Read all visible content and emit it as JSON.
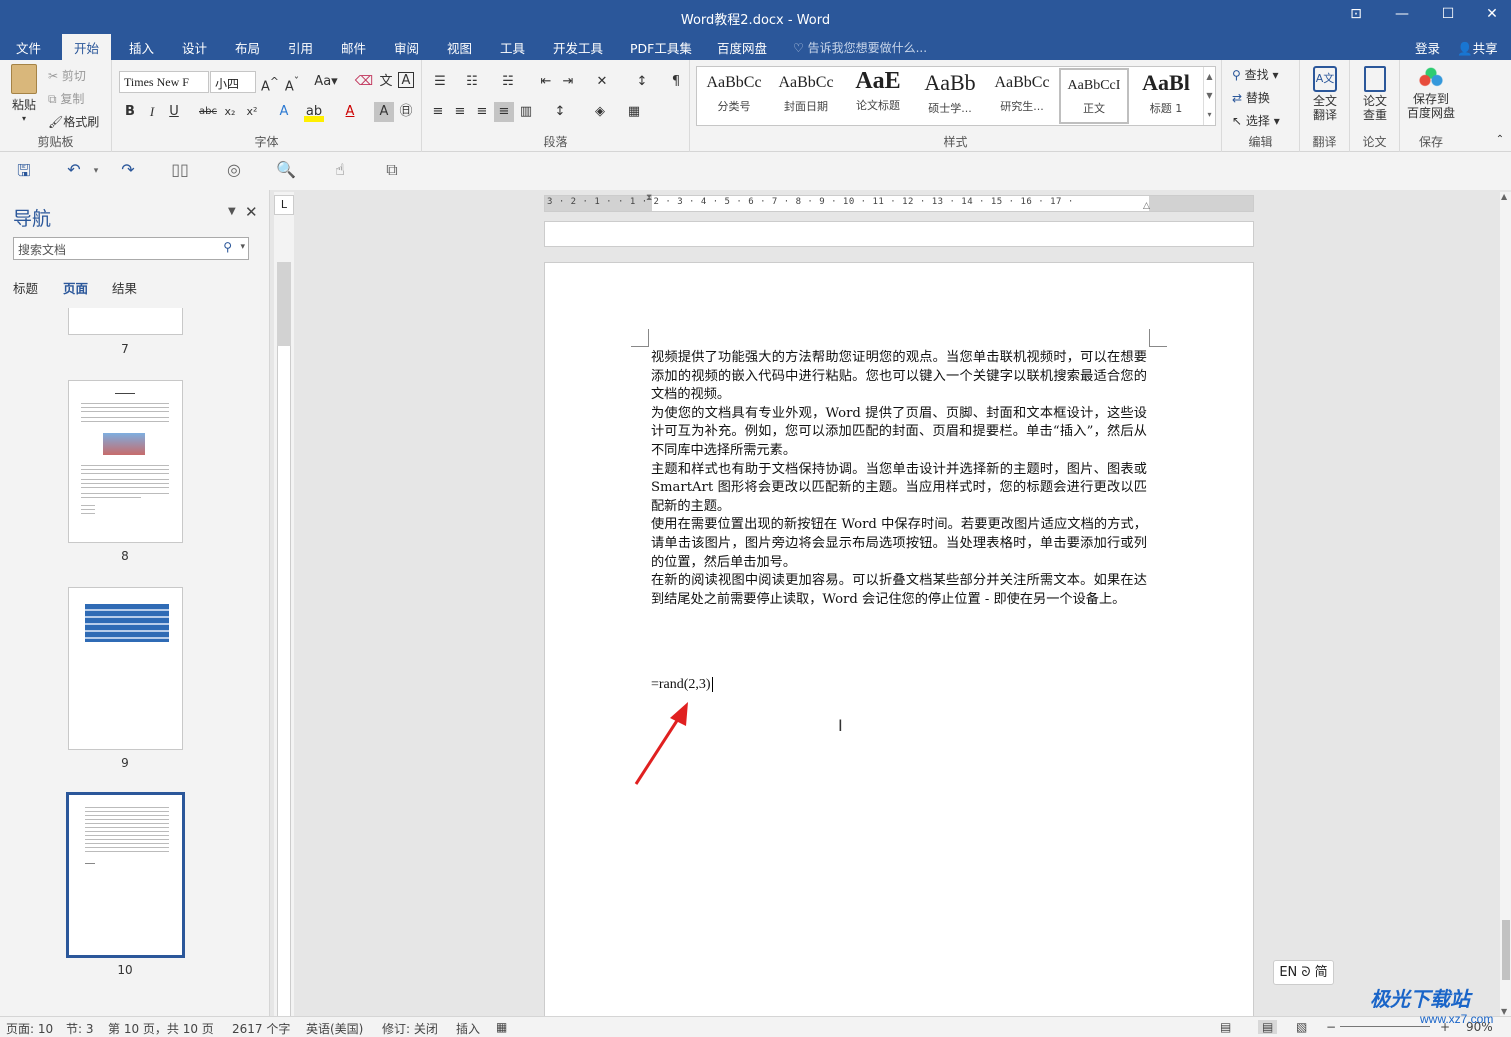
{
  "window": {
    "title": "Word教程2.docx - Word"
  },
  "tabs": [
    "文件",
    "开始",
    "插入",
    "设计",
    "布局",
    "引用",
    "邮件",
    "审阅",
    "视图",
    "工具",
    "开发工具",
    "PDF工具集",
    "百度网盘"
  ],
  "tell_me": "告诉我您想要做什么...",
  "account": {
    "login": "登录",
    "share": "共享"
  },
  "ribbon": {
    "clipboard": {
      "paste": "粘贴",
      "cut": "剪切",
      "copy": "复制",
      "format_painter": "格式刷",
      "label": "剪贴板"
    },
    "font": {
      "name": "Times New F",
      "size": "小四",
      "label": "字体"
    },
    "paragraph": {
      "label": "段落"
    },
    "styles": {
      "label": "样式",
      "items": [
        {
          "preview": "AaBbCc",
          "name": "分类号"
        },
        {
          "preview": "AaBbCc",
          "name": "封面日期"
        },
        {
          "preview": "AaE",
          "name": "论文标题"
        },
        {
          "preview": "AaBb",
          "name": "硕士学..."
        },
        {
          "preview": "AaBbCc",
          "name": "研究生..."
        },
        {
          "preview": "AaBbCcI",
          "name": "正文"
        },
        {
          "preview": "AaBl",
          "name": "标题 1"
        }
      ]
    },
    "editing": {
      "find": "查找",
      "replace": "替换",
      "select": "选择",
      "label": "编辑"
    },
    "translate": {
      "btn": "全文\n翻译",
      "label": "翻译"
    },
    "paper": {
      "btn": "论文\n查重",
      "label": "论文"
    },
    "save": {
      "btn": "保存到\n百度网盘",
      "label": "保存"
    }
  },
  "nav": {
    "title": "导航",
    "search_placeholder": "搜索文档",
    "tabs": [
      "标题",
      "页面",
      "结果"
    ],
    "pages": [
      "7",
      "8",
      "9",
      "10"
    ]
  },
  "ruler": {
    "numbers": "3 · 2 · 1 ·   · 1 · 2 · 3 · 4 · 5 · 6 · 7 · 8 · 9 · 10 · 11 · 12 · 13 · 14 · 15 · 16 · 17 ·"
  },
  "document": {
    "paragraphs": [
      "视频提供了功能强大的方法帮助您证明您的观点。当您单击联机视频时，可以在想要添加的视频的嵌入代码中进行粘贴。您也可以键入一个关键字以联机搜索最适合您的文档的视频。",
      "为使您的文档具有专业外观，Word 提供了页眉、页脚、封面和文本框设计，这些设计可互为补充。例如，您可以添加匹配的封面、页眉和提要栏。单击“插入”，然后从不同库中选择所需元素。",
      "主题和样式也有助于文档保持协调。当您单击设计并选择新的主题时，图片、图表或 SmartArt 图形将会更改以匹配新的主题。当应用样式时，您的标题会进行更改以匹配新的主题。",
      "使用在需要位置出现的新按钮在 Word 中保存时间。若要更改图片适应文档的方式，请单击该图片，图片旁边将会显示布局选项按钮。当处理表格时，单击要添加行或列的位置，然后单击加号。",
      "在新的阅读视图中阅读更加容易。可以折叠文档某些部分并关注所需文本。如果在达到结尾处之前需要停止读取，Word 会记住您的停止位置 - 即使在另一个设备上。"
    ],
    "formula": "=rand(2,3)"
  },
  "ime": "EN ᘐ 简",
  "status": {
    "page": "页面: 10",
    "section": "节: 3",
    "page_of": "第 10 页，共 10 页",
    "words": "2617 个字",
    "language": "英语(美国)",
    "track": "修订: 关闭",
    "mode": "插入",
    "zoom": "90%"
  },
  "watermark": {
    "text": "极光下载站",
    "url": "www.xz7.com"
  }
}
